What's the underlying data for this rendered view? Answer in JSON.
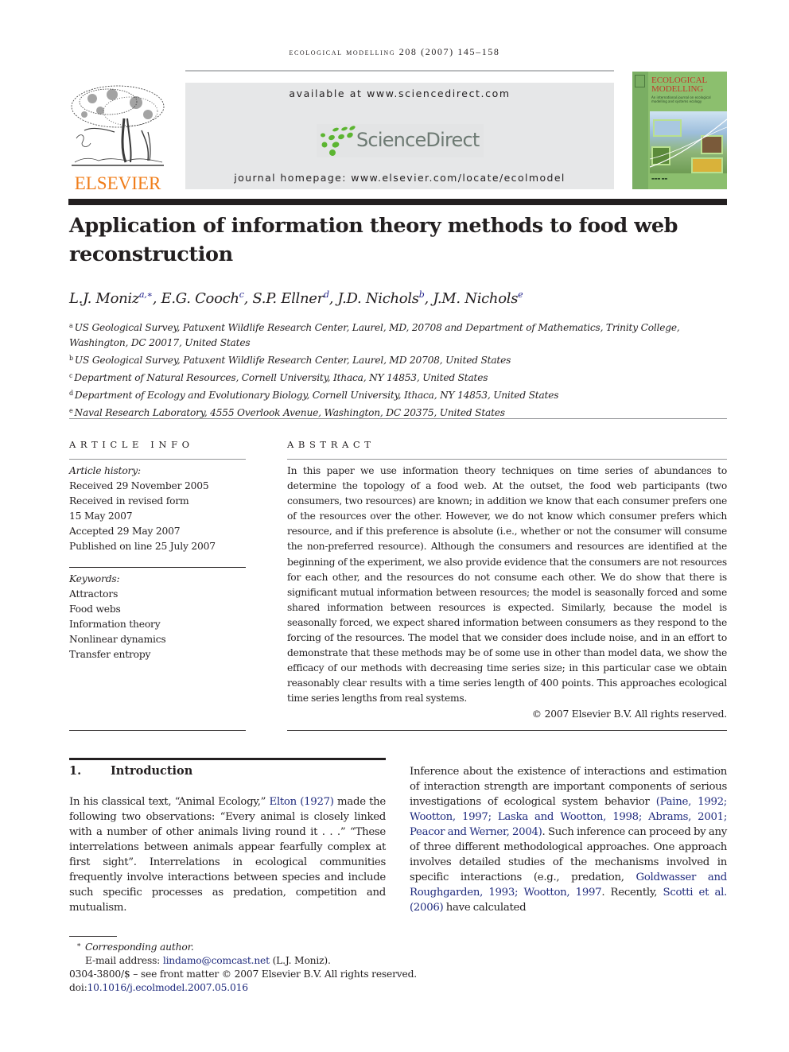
{
  "running_header": "ecological modelling 208 (2007) 145–158",
  "masthead": {
    "publisher_logo": "ELSEVIER",
    "available_at": "available at www.sciencedirect.com",
    "sciencedirect_logo": "ScienceDirect",
    "journal_homepage": "journal homepage: www.elsevier.com/locate/ecolmodel",
    "cover": {
      "title_line1": "ECOLOGICAL",
      "title_line2": "MODELLING",
      "subtitle": "An international journal on ecological modelling and systems ecology"
    },
    "colors": {
      "elsevier_orange": "#f07d1a",
      "sciencedirect_green": "#5cb531",
      "cover_green": "#8cbf6e"
    }
  },
  "article": {
    "title": "Application of information theory methods to food web reconstruction",
    "authors": [
      {
        "name": "L.J. Moniz",
        "sup": "a,∗"
      },
      {
        "name": "E.G. Cooch",
        "sup": "c"
      },
      {
        "name": "S.P. Ellner",
        "sup": "d"
      },
      {
        "name": "J.D. Nichols",
        "sup": "b"
      },
      {
        "name": "J.M. Nichols",
        "sup": "e"
      }
    ],
    "affiliations": [
      {
        "key": "a",
        "text": "US Geological Survey, Patuxent Wildlife Research Center, Laurel, MD, 20708 and Department of Mathematics, Trinity College, Washington, DC 20017, United States"
      },
      {
        "key": "b",
        "text": "US Geological Survey, Patuxent Wildlife Research Center, Laurel, MD 20708, United States"
      },
      {
        "key": "c",
        "text": "Department of Natural Resources, Cornell University, Ithaca, NY 14853, United States"
      },
      {
        "key": "d",
        "text": "Department of Ecology and Evolutionary Biology, Cornell University, Ithaca, NY 14853, United States"
      },
      {
        "key": "e",
        "text": "Naval Research Laboratory, 4555 Overlook Avenue, Washington, DC 20375, United States"
      }
    ]
  },
  "article_info": {
    "heading": "ARTICLE INFO",
    "history_label": "Article history:",
    "history": [
      "Received 29 November 2005",
      "Received in revised form",
      "15 May 2007",
      "Accepted 29 May 2007",
      "Published on line 25 July 2007"
    ],
    "keywords_label": "Keywords:",
    "keywords": [
      "Attractors",
      "Food webs",
      "Information theory",
      "Nonlinear dynamics",
      "Transfer entropy"
    ]
  },
  "abstract": {
    "heading": "ABSTRACT",
    "text": "In this paper we use information theory techniques on time series of abundances to determine the topology of a food web. At the outset, the food web participants (two consumers, two resources) are known; in addition we know that each consumer prefers one of the resources over the other. However, we do not know which consumer prefers which resource, and if this preference is absolute (i.e., whether or not the consumer will consume the non-preferred resource). Although the consumers and resources are identified at the beginning of the experiment, we also provide evidence that the consumers are not resources for each other, and the resources do not consume each other. We do show that there is significant mutual information between resources; the model is seasonally forced and some shared information between resources is expected. Similarly, because the model is seasonally forced, we expect shared information between consumers as they respond to the forcing of the resources. The model that we consider does include noise, and in an effort to demonstrate that these methods may be of some use in other than model data, we show the efficacy of our methods with decreasing time series size; in this particular case we obtain reasonably clear results with a time series length of 400 points. This approaches ecological time series lengths from real systems.",
    "copyright": "© 2007 Elsevier B.V. All rights reserved."
  },
  "introduction": {
    "number": "1.",
    "heading": "Introduction",
    "left_parts": [
      {
        "t": "In his classical text, “Animal Ecology,” "
      },
      {
        "t": "Elton (1927)",
        "cite": true
      },
      {
        "t": " made the following two observations: “Every animal is closely linked with a number of other animals living round it . . .” “These interrelations between animals appear fearfully complex at first sight”. Interrelations in ecological communities frequently involve interactions between species and include such specific processes as predation, competition and mutualism."
      }
    ],
    "right_parts": [
      {
        "t": "Inference about the existence of interactions and estimation of interaction strength are important components of serious investigations of ecological system behavior "
      },
      {
        "t": "(Paine, 1992; Wootton, 1997; Laska and Wootton, 1998; Abrams, 2001; Peacor and Werner, 2004)",
        "cite": true
      },
      {
        "t": ". Such inference can proceed by any of three different methodological approaches. One approach involves detailed studies of the mechanisms involved in specific interactions (e.g., predation, "
      },
      {
        "t": "Goldwasser and Roughgarden, 1993; Wootton, 1997",
        "cite": true
      },
      {
        "t": ". Recently, "
      },
      {
        "t": "Scotti et al. (2006)",
        "cite": true
      },
      {
        "t": " have calculated"
      }
    ]
  },
  "footnotes": {
    "corresponding_marker": "∗",
    "corresponding_label": "Corresponding author.",
    "email_label": "E-mail address: ",
    "email": "lindamo@comcast.net",
    "email_owner": " (L.J. Moniz).",
    "front_matter": "0304-3800/$ – see front matter © 2007 Elsevier B.V. All rights reserved.",
    "doi_label": "doi:",
    "doi": "10.1016/j.ecolmodel.2007.05.016"
  }
}
